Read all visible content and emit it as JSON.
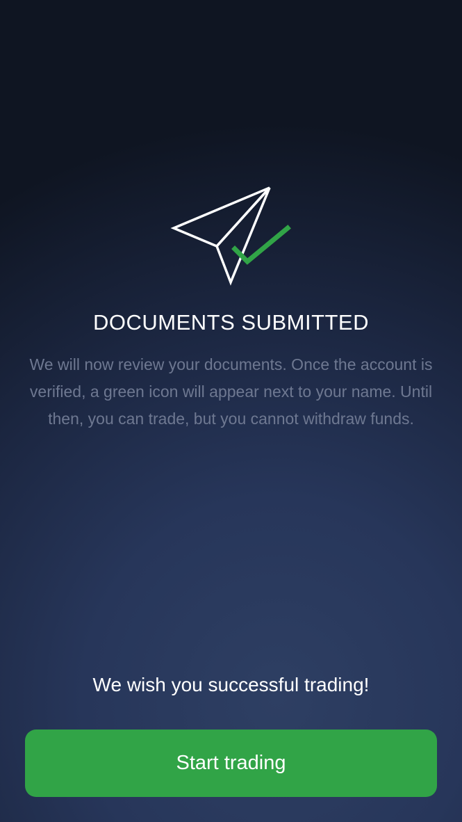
{
  "icons": {
    "hero": "paper-plane-check-icon"
  },
  "colors": {
    "accent": "#31a447",
    "title": "#ffffff",
    "description": "#6e7891"
  },
  "content": {
    "title": "DOCUMENTS SUBMITTED",
    "description": "We will now review your documents. Once the account is verified, a green icon will appear next to your name. Until then, you can trade, but you cannot withdraw funds.",
    "wish": "We wish you successful trading!"
  },
  "actions": {
    "start_trading_label": "Start trading"
  }
}
